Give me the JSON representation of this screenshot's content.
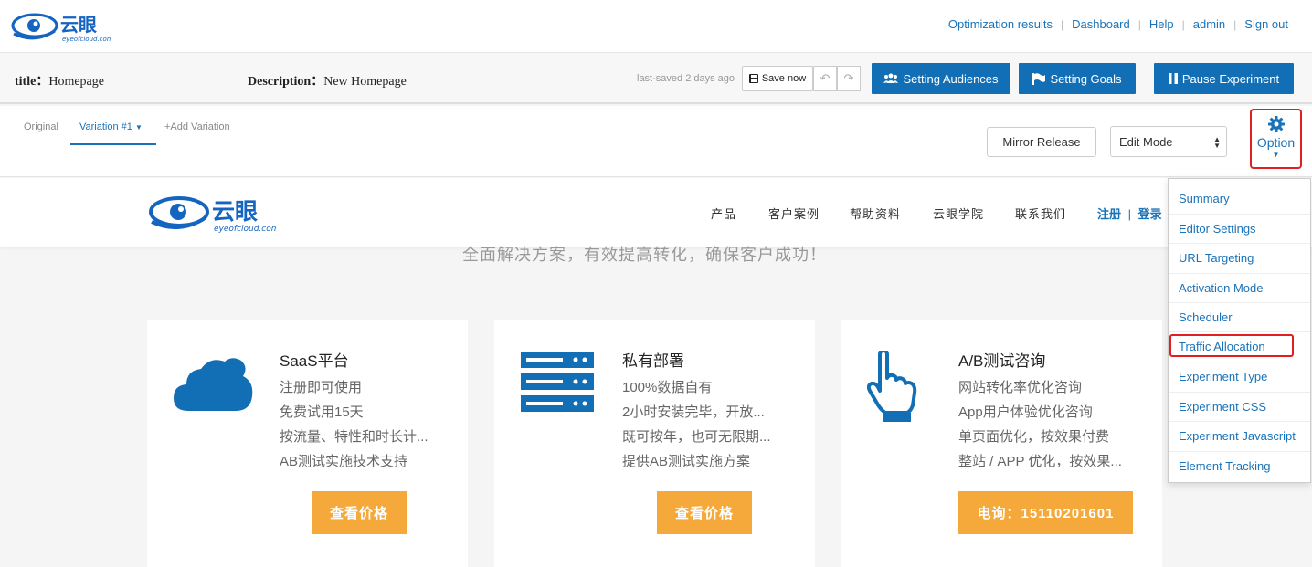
{
  "brand": {
    "name_cn": "云眼",
    "name_en": "eyeofcloud.com"
  },
  "topnav": {
    "links": [
      "Optimization results",
      "Dashboard",
      "Help",
      "admin",
      "Sign out"
    ],
    "separator": "|"
  },
  "editor": {
    "title_label": "title：",
    "title_value": "Homepage",
    "desc_label": "Description：",
    "desc_value": "New Homepage",
    "last_saved": "last-saved 2 days ago",
    "save_label": "Save now",
    "audiences_label": "Setting Audiences",
    "goals_label": "Setting Goals",
    "pause_label": "Pause Experiment"
  },
  "variations": {
    "original": "Original",
    "active": "Variation #1",
    "add": "+Add Variation",
    "mirror_label": "Mirror Release",
    "mode_value": "Edit Mode",
    "option_label": "Option"
  },
  "site": {
    "nav": [
      "产品",
      "客户案例",
      "帮助资料",
      "云眼学院",
      "联系我们"
    ],
    "register": "注册",
    "login": "登录",
    "reg_sep": "|",
    "slogan": "全面解决方案，有效提高转化，确保客户成功！",
    "cards": [
      {
        "title": "SaaS平台",
        "lines": [
          "注册即可使用",
          "免费试用15天",
          "按流量、特性和时长计...",
          "AB测试实施技术支持"
        ],
        "button": "查看价格"
      },
      {
        "title": "私有部署",
        "lines": [
          "100%数据自有",
          "2小时安装完毕，开放...",
          "既可按年，也可无限期...",
          "提供AB测试实施方案"
        ],
        "button": "查看价格"
      },
      {
        "title": "A/B测试咨询",
        "lines": [
          "网站转化率优化咨询",
          "App用户体验优化咨询",
          "单页面优化，按效果付费",
          "整站 / APP 优化，按效果..."
        ],
        "button": "电询：15110201601"
      }
    ]
  },
  "dropdown": {
    "items": [
      "Summary",
      "Editor Settings",
      "URL Targeting",
      "Activation Mode",
      "Scheduler",
      "Traffic Allocation",
      "Experiment Type",
      "Experiment CSS",
      "Experiment Javascript",
      "Element Tracking"
    ],
    "highlighted": "Traffic Allocation"
  },
  "colors": {
    "primary": "#136fb5",
    "link": "#1a73b8",
    "accent_orange": "#f5a93b",
    "highlight_red": "#e02020"
  }
}
